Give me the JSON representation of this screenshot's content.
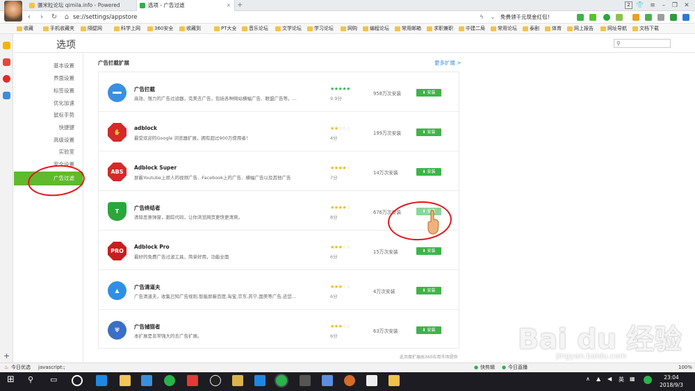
{
  "tabs": [
    {
      "label": "骡米粒论坛 qimila.info - Powered"
    },
    {
      "label": "选项 - 广告过滤"
    }
  ],
  "window": {
    "badge": "2"
  },
  "address": {
    "url": "se://settings/appstore",
    "promo": "免费领千元现金红包！"
  },
  "bookmarks": [
    "收藏",
    "手机收藏夹",
    "隔壁网",
    "科学上网",
    "360安全",
    "收藏到",
    "PT大全",
    "音乐论坛",
    "文学论坛",
    "学习论坛",
    "网购",
    "编程论坛",
    "常用邮箱",
    "求职兼职",
    "中建二局",
    "常用论坛",
    "泰剧",
    "体育",
    "网上报告",
    "网址导航",
    "文档下载"
  ],
  "page": {
    "title": "选项",
    "section_title": "广告拦截扩展",
    "more_link": "更多扩展 >",
    "footnote": "此页面扩展由360应用市场提供"
  },
  "sidebar": {
    "items": [
      {
        "label": "基本设置"
      },
      {
        "label": "界面设置"
      },
      {
        "label": "标签设置"
      },
      {
        "label": "优化加速"
      },
      {
        "label": "鼠标手势"
      },
      {
        "label": "快捷键"
      },
      {
        "label": "高级设置"
      },
      {
        "label": "实验室"
      },
      {
        "label": "安全设置"
      },
      {
        "label": "广告过滤"
      }
    ],
    "active_index": 9
  },
  "extensions": [
    {
      "name": "广告拦截",
      "desc": "高效、强力的广告过滤器，完美去广告，包括各种网站横幅广告、联盟广告等。...",
      "rating": 5,
      "score": "9.9分",
      "installs": "958万次安装",
      "install_label": "安装",
      "icon": "minus-icon",
      "icon_text": "",
      "color": "#3b8fe0"
    },
    {
      "name": "adblock",
      "desc": "最受欢迎的Google 浏览器扩展，拥有超过900万使用者！",
      "rating": 2,
      "score": "4分",
      "installs": "199万次安装",
      "install_label": "安装",
      "icon": "hand-stop-icon",
      "icon_text": "✋",
      "color": "#d42a2a"
    },
    {
      "name": "Adblock Super",
      "desc": "屏蔽Youtube上烦人的视频广告、Facebook上的广告、横幅广告以及其他广告",
      "rating": 3.5,
      "score": "7分",
      "installs": "14万次安装",
      "install_label": "安装",
      "icon": "abs-icon",
      "icon_text": "ABS",
      "color": "#d42a2a"
    },
    {
      "name": "广告终结者",
      "desc": "清除恶意弹窗，跟踪代码，让你浏览网页更快更清爽。",
      "rating": 4,
      "score": "8分",
      "installs": "676万次安装",
      "install_label": "安装",
      "icon": "shield-t-icon",
      "icon_text": "T",
      "color": "#2ba63a"
    },
    {
      "name": "Adblock Pro",
      "desc": "最好的免费广告过滤工具，简单好用，功能全面",
      "rating": 3,
      "score": "6分",
      "installs": "15万次安装",
      "install_label": "安装",
      "icon": "pro-icon",
      "icon_text": "PRO",
      "color": "#c81e1e"
    },
    {
      "name": "广告清道夫",
      "desc": "广告清道夫，收集已知广告规则,智能屏蔽百度,淘宝,京东,苏宁,国美等广告,还您...",
      "rating": 3,
      "score": "6分",
      "installs": "4万次安装",
      "install_label": "安装",
      "icon": "triangle-icon",
      "icon_text": "▲",
      "color": "#2f8fe6"
    },
    {
      "name": "广告捕猎者",
      "desc": "本扩展是非常强大的去广告扩展。",
      "rating": 3,
      "score": "6分",
      "installs": "63万次安装",
      "install_label": "安装",
      "icon": "shield-icon",
      "icon_text": "⛨",
      "color": "#3a6fc4"
    }
  ],
  "status": {
    "left": "今日优选",
    "js": "javascript:;",
    "kuaijian": "快剪辑",
    "zhibo": "今日直播",
    "zoom": "100%"
  },
  "taskbar": {
    "time": "23:04",
    "date": "2018/9/3",
    "ime": "英"
  },
  "watermark": {
    "brand": "Bai du 经验",
    "url": "jingyan.baidu.com"
  }
}
